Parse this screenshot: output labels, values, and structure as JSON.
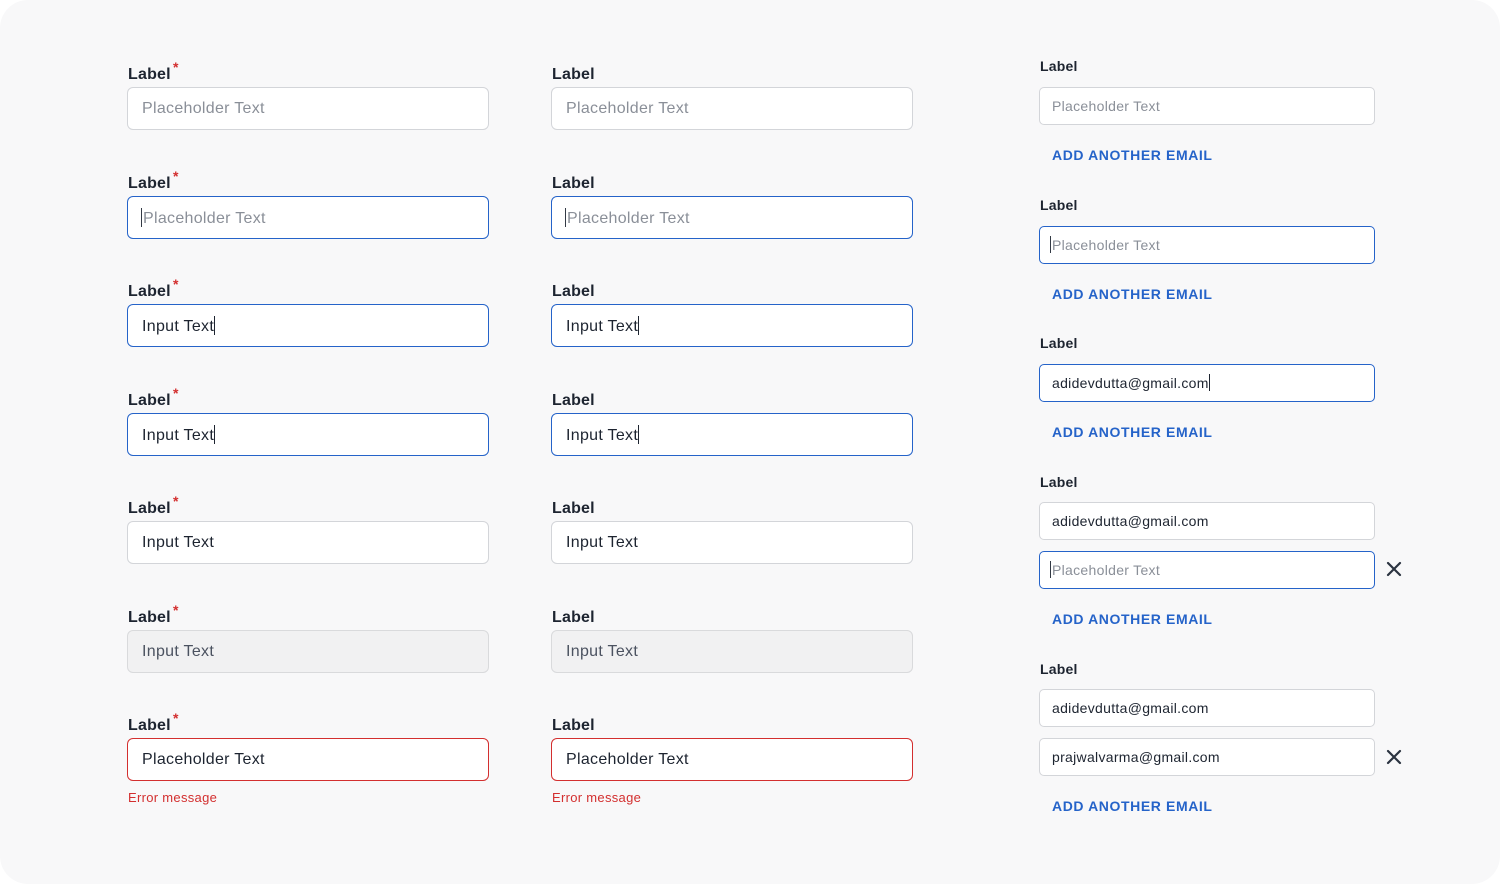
{
  "colors": {
    "primary": "#2563c9",
    "error": "#d32f2f",
    "border": "#d3d5d9",
    "disabled_bg": "#f1f1f2",
    "text": "#1d2430",
    "placeholder": "#8a8f98"
  },
  "required_mark": "*",
  "column_left": {
    "fields": [
      {
        "label": "Label",
        "state": "default",
        "text": "Placeholder Text"
      },
      {
        "label": "Label",
        "state": "focused-empty",
        "text": "Placeholder Text"
      },
      {
        "label": "Label",
        "state": "typing",
        "text": "Input Text"
      },
      {
        "label": "Label",
        "state": "selected",
        "text": "Input Text"
      },
      {
        "label": "Label",
        "state": "filled",
        "text": "Input Text"
      },
      {
        "label": "Label",
        "state": "disabled",
        "text": "Input Text"
      },
      {
        "label": "Label",
        "state": "error",
        "text": "Placeholder Text",
        "error_message": "Error message"
      }
    ]
  },
  "column_middle": {
    "fields": [
      {
        "label": "Label",
        "state": "default",
        "text": "Placeholder Text"
      },
      {
        "label": "Label",
        "state": "focused-empty",
        "text": "Placeholder Text"
      },
      {
        "label": "Label",
        "state": "typing",
        "text": "Input Text"
      },
      {
        "label": "Label",
        "state": "selected",
        "text": "Input Text"
      },
      {
        "label": "Label",
        "state": "filled",
        "text": "Input Text"
      },
      {
        "label": "Label",
        "state": "disabled",
        "text": "Input Text"
      },
      {
        "label": "Label",
        "state": "error",
        "text": "Placeholder Text",
        "error_message": "Error message"
      }
    ]
  },
  "column_email": {
    "add_link": "ADD ANOTHER EMAIL",
    "groups": [
      {
        "label": "Label",
        "inputs": [
          {
            "text": "Placeholder Text",
            "state": "default"
          }
        ]
      },
      {
        "label": "Label",
        "inputs": [
          {
            "text": "Placeholder Text",
            "state": "focused-empty"
          }
        ]
      },
      {
        "label": "Label",
        "inputs": [
          {
            "text": "adidevdutta@gmail.com",
            "state": "typing"
          }
        ]
      },
      {
        "label": "Label",
        "inputs": [
          {
            "text": "adidevdutta@gmail.com",
            "state": "filled"
          },
          {
            "text": "Placeholder Text",
            "state": "focused-empty",
            "removable": true
          }
        ]
      },
      {
        "label": "Label",
        "inputs": [
          {
            "text": "adidevdutta@gmail.com",
            "state": "filled"
          },
          {
            "text": "prajwalvarma@gmail.com",
            "state": "filled",
            "removable": true
          }
        ]
      }
    ]
  }
}
